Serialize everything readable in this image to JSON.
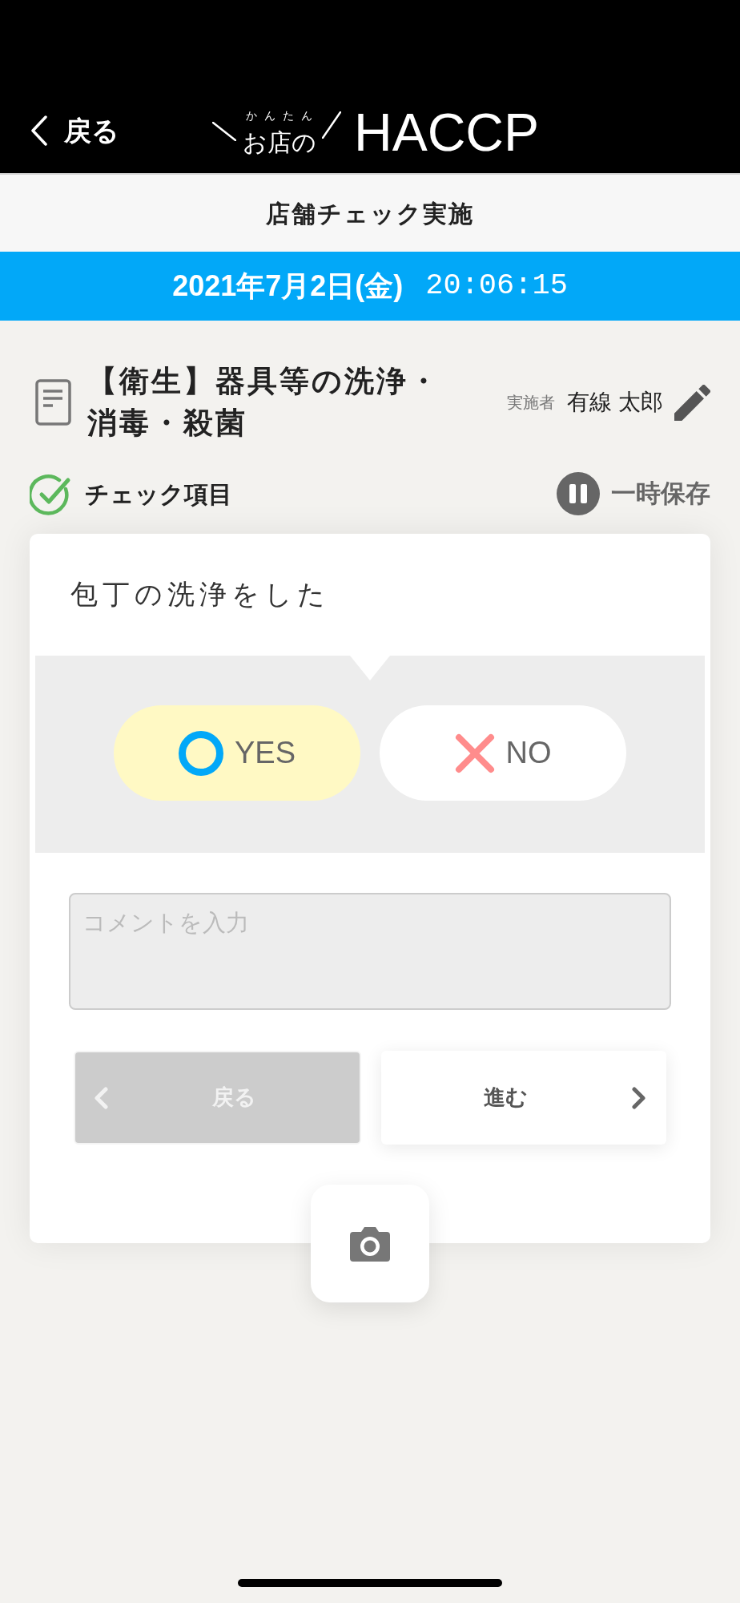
{
  "header": {
    "back_label": "戻る",
    "logo": {
      "ruby": "かんたん",
      "prefix": "お店の",
      "name": "HACCP"
    }
  },
  "page_title": "店舗チェック実施",
  "datetime": {
    "date": "2021年7月2日(金)",
    "time": "20:06:15"
  },
  "task": {
    "title": "【衛生】器具等の洗浄・消毒・殺菌",
    "performer_label": "実施者",
    "performer": "有線 太郎"
  },
  "check_header": {
    "label": "チェック項目",
    "pause_label": "一時保存"
  },
  "question": {
    "text": "包丁の洗浄をした",
    "answers": [
      {
        "kind": "yes",
        "label": "YES",
        "selected": true
      },
      {
        "kind": "no",
        "label": "NO",
        "selected": false
      }
    ],
    "comment": {
      "placeholder": "コメントを入力"
    },
    "nav": [
      {
        "kind": "prev",
        "label": "戻る",
        "disabled": true
      },
      {
        "kind": "next",
        "label": "進む",
        "disabled": false
      }
    ]
  }
}
